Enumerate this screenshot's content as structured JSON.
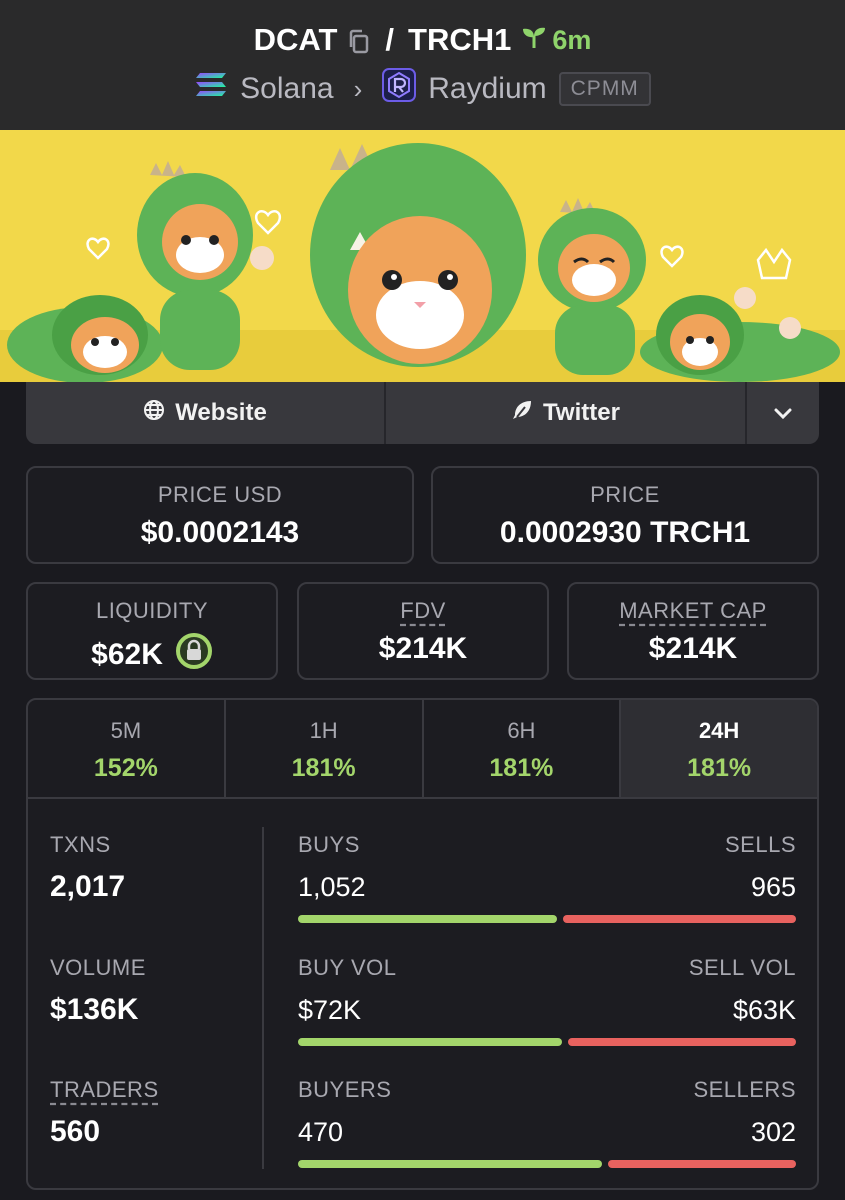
{
  "header": {
    "base_token": "DCAT",
    "separator": "/",
    "quote_token": "TRCH1",
    "age": "6m",
    "chain": "Solana",
    "dex": "Raydium",
    "pool_type": "CPMM"
  },
  "links": {
    "website": "Website",
    "twitter": "Twitter"
  },
  "prices": {
    "price_usd_label": "PRICE USD",
    "price_usd": "$0.0002143",
    "price_label": "PRICE",
    "price": "0.0002930 TRCH1"
  },
  "metrics": {
    "liquidity_label": "LIQUIDITY",
    "liquidity": "$62K",
    "fdv_label": "FDV",
    "fdv": "$214K",
    "mcap_label": "MARKET CAP",
    "mcap": "$214K"
  },
  "periods": [
    {
      "label": "5M",
      "change": "152%"
    },
    {
      "label": "1H",
      "change": "181%"
    },
    {
      "label": "6H",
      "change": "181%"
    },
    {
      "label": "24H",
      "change": "181%"
    }
  ],
  "selected_period": "24H",
  "stats": {
    "txns_label": "TXNS",
    "txns": "2,017",
    "volume_label": "VOLUME",
    "volume": "$136K",
    "traders_label": "TRADERS",
    "traders": "560",
    "buys_label": "BUYS",
    "buys": "1,052",
    "sells_label": "SELLS",
    "sells": "965",
    "buy_vol_label": "BUY VOL",
    "buy_vol": "$72K",
    "sell_vol_label": "SELL VOL",
    "sell_vol": "$63K",
    "buyers_label": "BUYERS",
    "buyers": "470",
    "sellers_label": "SELLERS",
    "sellers": "302"
  },
  "ratios": {
    "buys_share": 0.52,
    "buy_vol_share": 0.53,
    "buyers_share": 0.61
  },
  "colors": {
    "buy": "#a3d56b",
    "sell": "#e8625f",
    "age": "#8fd46b",
    "banner_bg": "#f2d84a"
  }
}
